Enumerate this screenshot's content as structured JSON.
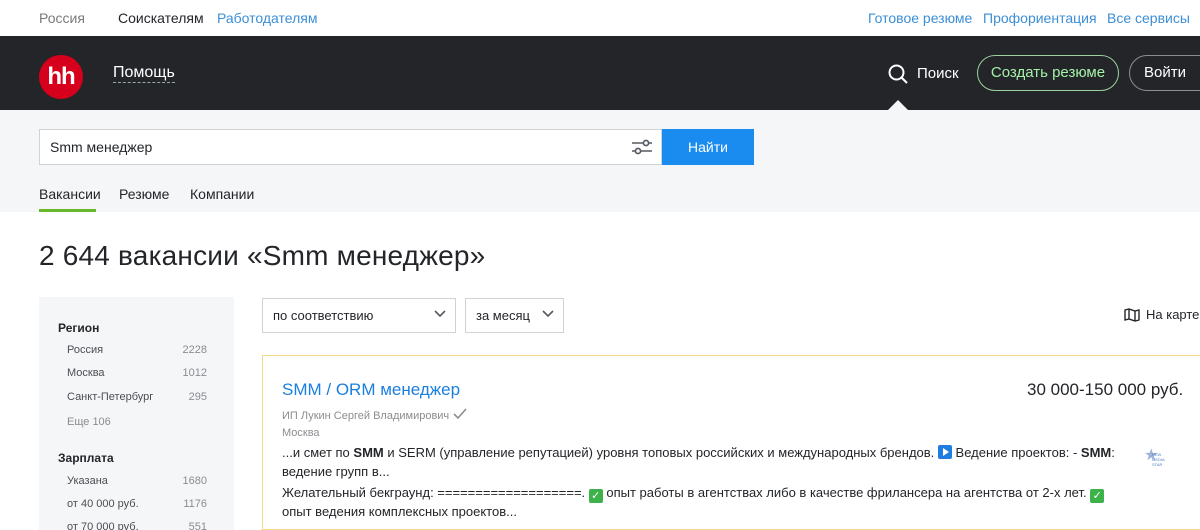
{
  "topbar": {
    "region": "Россия",
    "seekers": "Соискателям",
    "employers": "Работодателям",
    "ready_resume": "Готовое резюме",
    "career_guidance": "Профориентация",
    "all_services": "Все сервисы"
  },
  "header": {
    "logo_text": "hh",
    "help": "Помощь",
    "search": "Поиск",
    "create_resume": "Создать резюме",
    "login": "Войти"
  },
  "search": {
    "query": "Smm менеджер",
    "find_button": "Найти",
    "tabs": [
      "Вакансии",
      "Резюме",
      "Компании"
    ],
    "active_tab": "Вакансии"
  },
  "results": {
    "heading": "2 644 вакансии «Smm менеджер»",
    "sort_select": "по соответствию",
    "period_select": "за месяц",
    "map_link": "На карте"
  },
  "sidebar": {
    "region_title": "Регион",
    "regions": [
      {
        "name": "Россия",
        "count": "2228"
      },
      {
        "name": "Москва",
        "count": "1012"
      },
      {
        "name": "Санкт-Петербург",
        "count": "295"
      }
    ],
    "more": "Еще 106",
    "salary_title": "Зарплата",
    "salaries": [
      {
        "name": "Указана",
        "count": "1680"
      },
      {
        "name": "от 40 000 руб.",
        "count": "1176"
      },
      {
        "name": "от 70 000 руб.",
        "count": "551"
      }
    ]
  },
  "vacancy": {
    "title": "SMM / ORM менеджер",
    "salary": "30 000-150 000 руб.",
    "company": "ИП Лукин Сергей Владимирович",
    "city": "Москва",
    "line1_a": "...и смет по ",
    "line1_b": "SMM",
    "line1_c": " и SERM (управление репутацией) уровня топовых российских и международных брендов. ",
    "line1_d": " Ведение проектов: - ",
    "line1_e": "SMM",
    "line1_f": ":",
    "line2": "ведение групп в...",
    "line3_a": "Желательный бекграунд: ===================. ",
    "line3_b": " опыт работы в агентствах либо в качестве фрилансера на агентства от 2-х лет. ",
    "line4": "опыт ведения комплексных проектов...",
    "company_logo_text": "NEW MEDIA STAR"
  },
  "colors": {
    "header_bg": "#232529",
    "logo_red": "#d6001c",
    "link_blue": "#1a7fdf",
    "button_blue": "#1a8cf0",
    "tab_green": "#68b82e",
    "card_border": "#f5d98a"
  },
  "icons": [
    "search-icon",
    "filter-settings-icon",
    "chevron-down-icon",
    "map-icon",
    "verified-check-icon",
    "play-icon",
    "checkmark-icon"
  ]
}
